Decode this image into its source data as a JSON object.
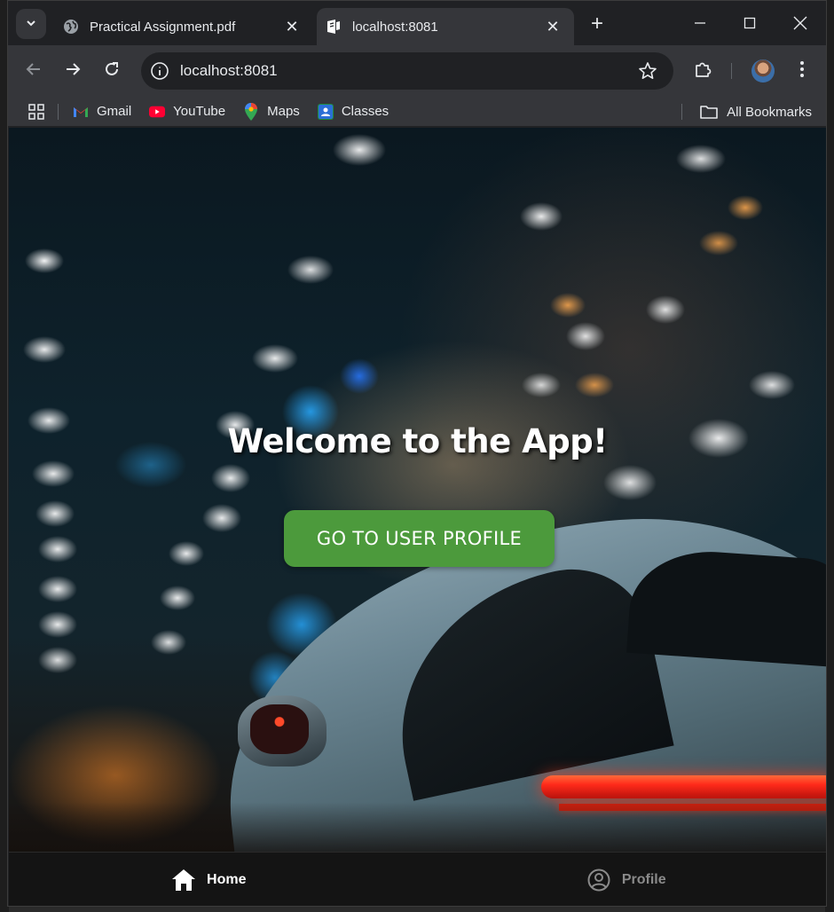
{
  "browser": {
    "tabs": [
      {
        "title": "Practical Assignment.pdf",
        "favicon": "globe-icon",
        "active": false
      },
      {
        "title": "localhost:8081",
        "favicon": "expo-icon",
        "active": true
      }
    ],
    "address": "localhost:8081",
    "bookmarks": [
      {
        "label": "Gmail",
        "icon": "gmail-icon"
      },
      {
        "label": "YouTube",
        "icon": "youtube-icon"
      },
      {
        "label": "Maps",
        "icon": "maps-icon"
      },
      {
        "label": "Classes",
        "icon": "classes-icon"
      }
    ],
    "all_bookmarks_label": "All Bookmarks"
  },
  "page": {
    "title": "Welcome to the App!",
    "cta_label": "GO TO USER PROFILE",
    "cta_color": "#4c9a3c"
  },
  "tabbar": {
    "items": [
      {
        "label": "Home",
        "icon": "home-icon",
        "active": true
      },
      {
        "label": "Profile",
        "icon": "user-circle-icon",
        "active": false
      }
    ]
  }
}
